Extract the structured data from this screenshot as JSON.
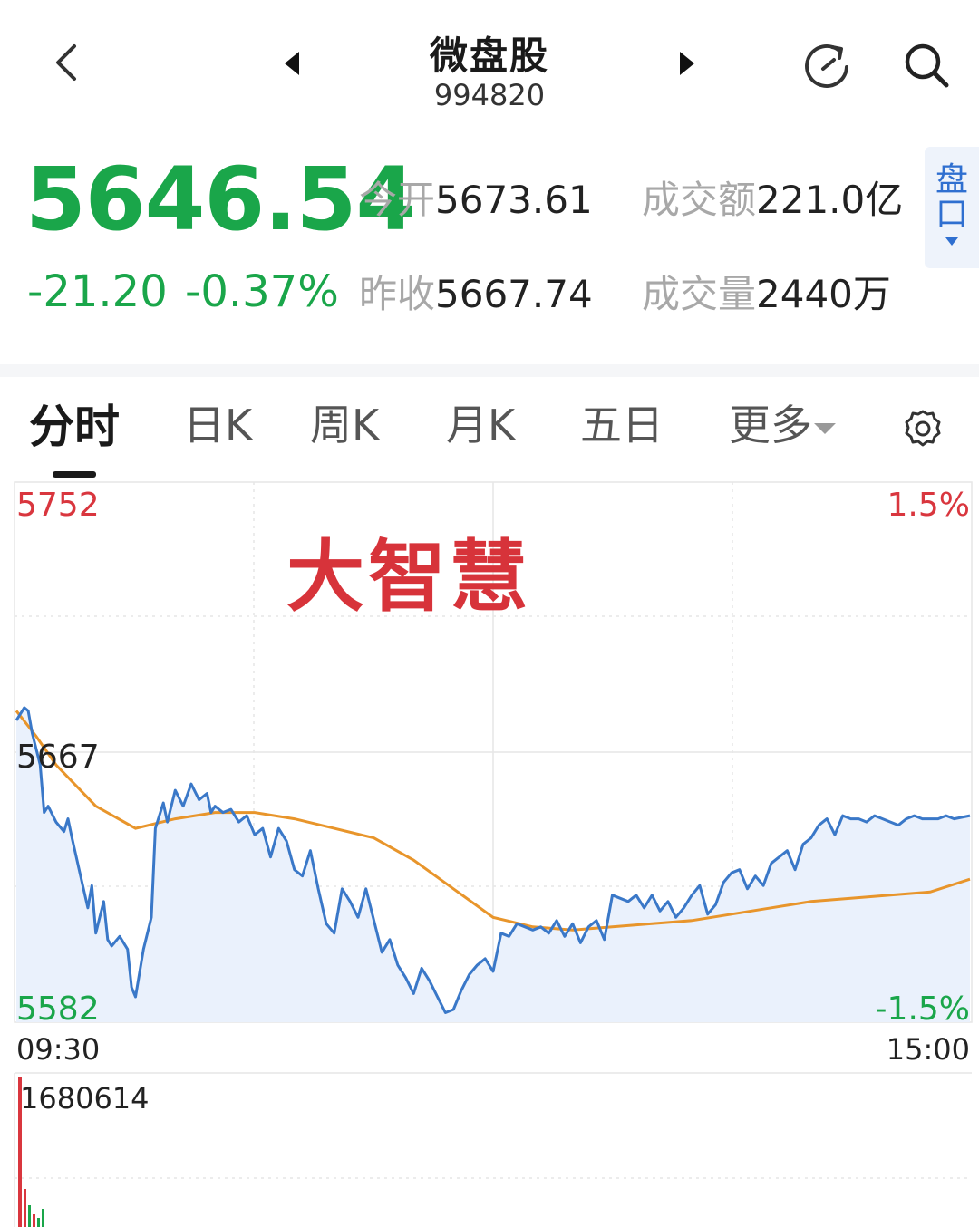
{
  "header": {
    "title": "微盘股",
    "code": "994820"
  },
  "quote": {
    "price": "5646.54",
    "change": "-21.20",
    "change_pct": "-0.37%",
    "open_label": "今开",
    "open_value": "5673.61",
    "prev_close_label": "昨收",
    "prev_close_value": "5667.74",
    "turnover_label": "成交额",
    "turnover_value": "221.0亿",
    "volume_label": "成交量",
    "volume_value": "2440万",
    "pankou_label_1": "盘",
    "pankou_label_2": "口"
  },
  "tabs": [
    {
      "label": "分时",
      "active": true
    },
    {
      "label": "日K",
      "active": false
    },
    {
      "label": "周K",
      "active": false
    },
    {
      "label": "月K",
      "active": false
    },
    {
      "label": "五日",
      "active": false
    },
    {
      "label": "更多",
      "active": false
    }
  ],
  "icons": {
    "back": "chevron-left-icon",
    "prev": "triangle-left-icon",
    "next": "triangle-right-icon",
    "refresh": "refresh-icon",
    "search": "search-icon",
    "settings": "gear-icon"
  },
  "colors": {
    "down": "#1aa64a",
    "up": "#d9363e",
    "price_line": "#3a78c8",
    "avg_line": "#e8952b",
    "area_fill": "#eaf1fc",
    "pankou": "#2f6fd0"
  },
  "chart": {
    "overlay_text": "大智慧",
    "y_max_label": "5752",
    "y_mid_label": "5667",
    "y_min_label": "5582",
    "pct_max_label": "1.5%",
    "pct_min_label": "-1.5%",
    "time_start": "09:30",
    "time_end": "15:00",
    "volume_max_label": "1680614"
  },
  "chart_data": {
    "type": "line",
    "ylim": [
      5582,
      5752
    ],
    "xlim": [
      0,
      240
    ],
    "prev_close": 5667,
    "series": [
      {
        "x": [
          0,
          2,
          3,
          4,
          6,
          7,
          8,
          10,
          12,
          13,
          14,
          16,
          18,
          19,
          20,
          21,
          22,
          23,
          24,
          26,
          28,
          29,
          30,
          32,
          34,
          35,
          36,
          37,
          38,
          40,
          42,
          44,
          46,
          48,
          49,
          50,
          52,
          54,
          56,
          58,
          60,
          62,
          64,
          66,
          68,
          70,
          72,
          74,
          76,
          78,
          80,
          82,
          84,
          86,
          88,
          90,
          92,
          94,
          96,
          98,
          100,
          102,
          104,
          106,
          108,
          110,
          112,
          114,
          116,
          118,
          120,
          122,
          124,
          126,
          128,
          130,
          132,
          134,
          136,
          138,
          140,
          142,
          144,
          146,
          148,
          150,
          152,
          154,
          156,
          158,
          160,
          162,
          164,
          166,
          168,
          170,
          172,
          174,
          176,
          178,
          180,
          182,
          184,
          186,
          188,
          190,
          192,
          194,
          196,
          198,
          200,
          202,
          204,
          206,
          208,
          210,
          212,
          214,
          216,
          218,
          220,
          222,
          224,
          226,
          228,
          230,
          232,
          234,
          236,
          240
        ],
        "values": [
          5677,
          5681,
          5680,
          5673,
          5663,
          5648,
          5650,
          5645,
          5642,
          5646,
          5640,
          5629,
          5618,
          5625,
          5610,
          5615,
          5620,
          5608,
          5606,
          5609,
          5605,
          5593,
          5590,
          5605,
          5615,
          5643,
          5647,
          5651,
          5645,
          5655,
          5650,
          5657,
          5652,
          5654,
          5648,
          5650,
          5648,
          5649,
          5645,
          5647,
          5641,
          5643,
          5634,
          5643,
          5639,
          5630,
          5628,
          5636,
          5624,
          5613,
          5610,
          5624,
          5620,
          5615,
          5624,
          5614,
          5604,
          5608,
          5600,
          5596,
          5591,
          5599,
          5595,
          5590,
          5585,
          5586,
          5592,
          5597,
          5600,
          5602,
          5598,
          5610,
          5609,
          5613,
          5612,
          5611,
          5612,
          5610,
          5614,
          5609,
          5613,
          5607,
          5612,
          5614,
          5608,
          5622,
          5621,
          5620,
          5622,
          5618,
          5622,
          5617,
          5620,
          5615,
          5618,
          5622,
          5625,
          5616,
          5619,
          5626,
          5629,
          5630,
          5624,
          5628,
          5625,
          5632,
          5634,
          5636,
          5630,
          5638,
          5640,
          5644,
          5646,
          5641,
          5647,
          5646,
          5646,
          5645,
          5647,
          5646,
          5645,
          5644,
          5646,
          5647,
          5646,
          5646,
          5646,
          5647,
          5646,
          5647
        ],
        "name": ""
      },
      {
        "x": [
          0,
          5,
          10,
          20,
          30,
          40,
          50,
          60,
          70,
          80,
          90,
          100,
          110,
          120,
          130,
          140,
          150,
          160,
          170,
          180,
          190,
          200,
          210,
          220,
          230,
          240
        ],
        "values": [
          5680,
          5672,
          5663,
          5650,
          5643,
          5646,
          5648,
          5648,
          5646,
          5643,
          5640,
          5633,
          5624,
          5615,
          5612,
          5611,
          5612,
          5613,
          5614,
          5616,
          5618,
          5620,
          5621,
          5622,
          5623,
          5627
        ],
        "name": ""
      }
    ]
  }
}
